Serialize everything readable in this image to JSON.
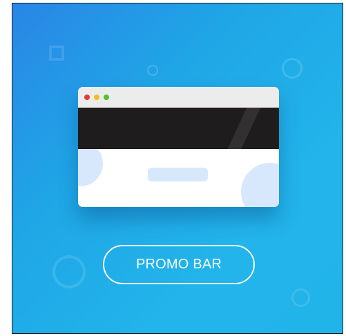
{
  "promo": {
    "button_label": "PROMO BAR"
  },
  "browser": {
    "window_controls": [
      "close-dot",
      "minimize-dot",
      "maximize-dot"
    ]
  },
  "colors": {
    "gradient_start": "#2a86e6",
    "gradient_end": "#21b4e9",
    "promo_strip": "#1e1c1d",
    "accent_light": "#d7e8fc",
    "close_dot": "#e93a2e",
    "minimize_dot": "#f2be1b",
    "maximize_dot": "#56c02f"
  }
}
